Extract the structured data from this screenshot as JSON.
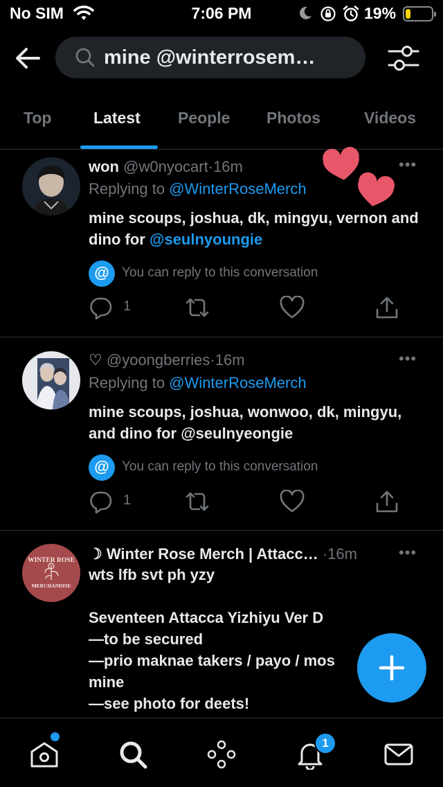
{
  "status_bar": {
    "carrier": "No SIM",
    "time": "7:06 PM",
    "battery": "19%",
    "battery_level": 0.19,
    "icons": [
      "wifi-icon",
      "moon-icon",
      "orientation-lock-icon",
      "alarm-icon",
      "battery-icon"
    ]
  },
  "search": {
    "query": "mine @winterrosem…",
    "icons": [
      "back-arrow-icon",
      "search-icon",
      "filter-icon"
    ]
  },
  "tabs": {
    "items": [
      {
        "label": "Top"
      },
      {
        "label": "Latest"
      },
      {
        "label": "People"
      },
      {
        "label": "Photos"
      },
      {
        "label": "Videos"
      }
    ],
    "active": "Latest"
  },
  "tweets": [
    {
      "name": "won",
      "handle": "@w0nyocart",
      "separator": "·",
      "ago": "16m",
      "more": "•••",
      "replying_prefix": "Replying to",
      "replying_to": "@WinterRoseMerch",
      "body_text": "mine scoups, joshua, dk, mingyu, vernon and dino for",
      "body_mention": "@seulnyoungie",
      "notice": "You can reply to this conversation",
      "reply_count": "1"
    },
    {
      "name": "♡",
      "handle": "@yoongberries",
      "separator": "·",
      "ago": "16m",
      "more": "•••",
      "replying_prefix": "Replying to",
      "replying_to": "@WinterRoseMerch",
      "body_text": "mine scoups, joshua, wonwoo, dk, mingyu, and dino for @seulnyeongie",
      "notice": "You can reply to this conversation",
      "reply_count": "1"
    },
    {
      "name": "☽ Winter Rose Merch | Attacc…",
      "separator": "·",
      "ago": "16m",
      "more": "•••",
      "avatar_top": "WINTER ROSE",
      "avatar_bottom": "MERCHANDISE",
      "lines": [
        "wts lfb svt ph yzy",
        "",
        "Seventeen Attacca Yizhiyu Ver D",
        "—to be secured",
        "—prio maknae takers / payo / mos",
        "mine",
        "—see photo for deets!"
      ]
    }
  ],
  "bottom_nav": {
    "items": [
      "home-icon",
      "search-icon",
      "spaces-icon",
      "notifications-icon",
      "messages-icon"
    ],
    "notification_badge": "1"
  },
  "colors": {
    "background": "#000000",
    "accent": "#1d9bf0",
    "text_primary": "#e7e9ea",
    "text_secondary": "#71767b",
    "divider": "#2f3336",
    "heart_sticker": "#e8566a"
  }
}
